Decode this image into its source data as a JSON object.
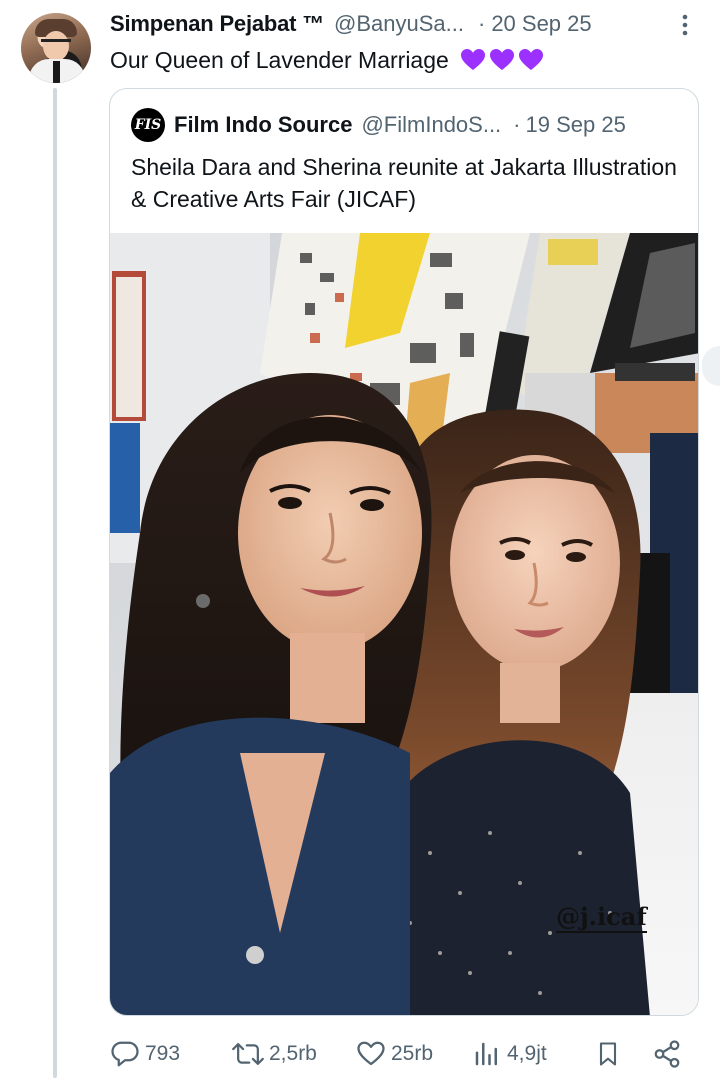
{
  "tweet": {
    "display_name": "Simpenan Pejabat ™",
    "handle": "@BanyuSa...",
    "separator": "·",
    "date": "20 Sep 25",
    "text": "Our Queen of Lavender Marriage",
    "emoji": [
      "purple-heart",
      "purple-heart",
      "purple-heart"
    ]
  },
  "quoted": {
    "logo_text": "FIS",
    "display_name": "Film Indo Source",
    "handle": "@FilmIndoS...",
    "separator": "·",
    "date": "19 Sep 25",
    "text": "Sheila Dara and Sherina reunite at Jakarta Illustration & Creative Arts Fair (JICAF)",
    "photo_watermark": "@j.icaf"
  },
  "actions": {
    "replies": "793",
    "reposts": "2,5rb",
    "likes": "25rb",
    "views": "4,9jt"
  },
  "colors": {
    "text_primary": "#0f1419",
    "text_secondary": "#536471",
    "border": "#cfd9de",
    "heart": "#9b30ff"
  }
}
